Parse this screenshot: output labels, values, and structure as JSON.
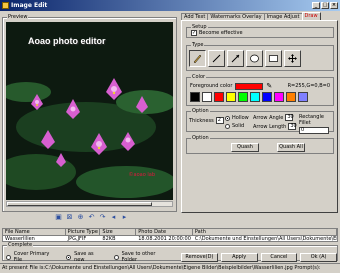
{
  "window": {
    "title": "Image Edit",
    "min": "_",
    "max": "□",
    "close": "×"
  },
  "preview": {
    "label": "Preview",
    "watermark_text": "Aoao photo editor",
    "copyright_text": "©aoao lab"
  },
  "tabs": [
    "Add Text",
    "Watermarks Overlay",
    "Image Adjust",
    "Draw"
  ],
  "setup": {
    "label": "Setup",
    "effective_label": "Become effective",
    "checked": true
  },
  "type": {
    "label": "Type",
    "tools": [
      "pencil-icon",
      "line-icon",
      "arrow-icon",
      "ellipse-icon",
      "rectangle-icon",
      "move-icon"
    ]
  },
  "color": {
    "label": "Color",
    "fg_label": "Foreground color",
    "fg_color": "#ff0000",
    "rgb_readout": "R=255,G=0,B=0",
    "swatches": [
      "#000000",
      "#ffffff",
      "#ff0000",
      "#ffff00",
      "#00ff00",
      "#00ffff",
      "#0000ff",
      "#ff00ff",
      "#ff8000",
      "#8080ff"
    ]
  },
  "option": {
    "label": "Option",
    "thickness_label": "Thickness",
    "thickness": "2",
    "hollow_label": "Hollow",
    "solid_label": "Solid",
    "arrow_angle_label": "Arrow Angle",
    "arrow_angle": "30",
    "arrow_length_label": "Arrow Length",
    "arrow_length": "30",
    "rect_fillet_label": "Rectangle Fillet",
    "rect_fillet": "0"
  },
  "option2": {
    "label": "Option",
    "quash_label": "Quash",
    "quash_all_label": "Quash All"
  },
  "table": {
    "headers": [
      "File Name",
      "Picture Type",
      "Size",
      "Photo Date",
      "Path"
    ],
    "rows": [
      [
        "Wasserlilien",
        "JPG,JFIF",
        "82KB",
        "18.08.2001 20:00:00",
        "C:\\Dokumente und Einstellungen\\All Users\\Dokumente\\Ei"
      ]
    ]
  },
  "complete": {
    "label": "Complete",
    "cover_label": "Cover Primary File",
    "save_new_label": "Save as new",
    "save_other_label": "Save to other Folder",
    "remove_label": "Remove(D)",
    "apply_label": "Apply",
    "cancel_label": "Cancel",
    "ok_label": "Ok (A)"
  },
  "status": "At present File is:C:\\Dokumente und Einstellungen\\All Users\\Dokumente\\Eigene Bilder\\Beispielbilder\\Wasserlilien.jpg  Prompt(s):"
}
